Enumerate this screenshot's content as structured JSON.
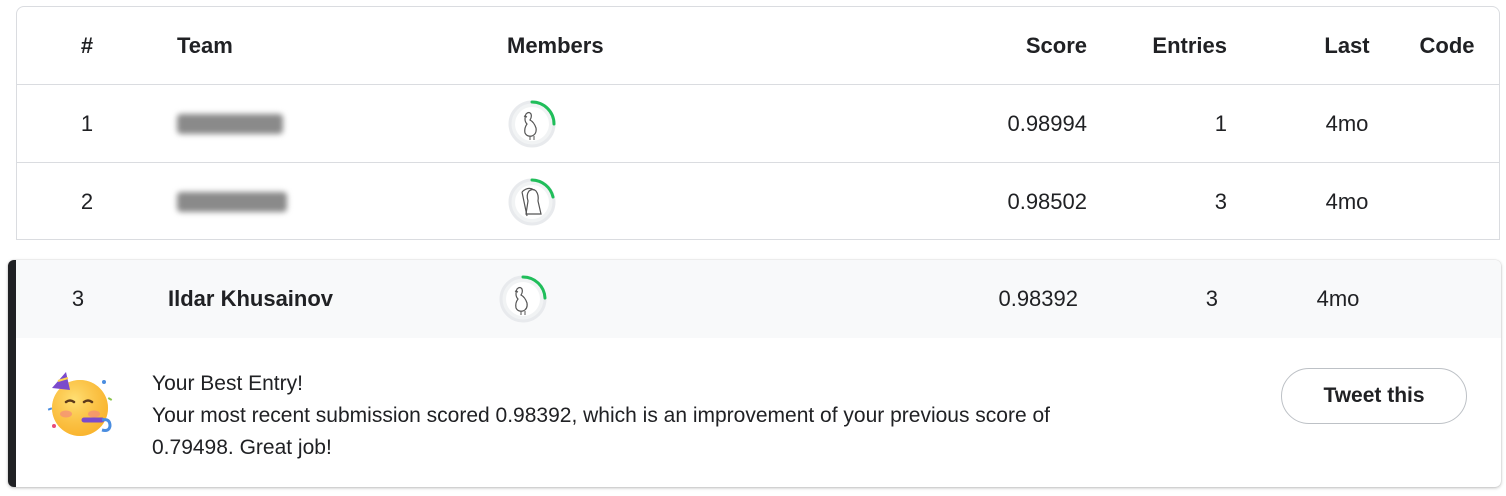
{
  "table": {
    "headers": {
      "rank": "#",
      "team": "Team",
      "members": "Members",
      "score": "Score",
      "entries": "Entries",
      "last": "Last",
      "code": "Code"
    },
    "rows": [
      {
        "rank": "1",
        "team": "",
        "team_redacted": true,
        "avatar": "turkey-avatar-icon",
        "score": "0.98994",
        "entries": "1",
        "last": "4mo"
      },
      {
        "rank": "2",
        "team": "",
        "team_redacted": true,
        "avatar": "reaper-avatar-icon",
        "score": "0.98502",
        "entries": "3",
        "last": "4mo"
      }
    ]
  },
  "user_row": {
    "rank": "3",
    "team": "Ildar Khusainov",
    "avatar": "turkey-avatar-icon",
    "score": "0.98392",
    "entries": "3",
    "last": "4mo"
  },
  "best_entry": {
    "icon": "partying-face-icon",
    "title": "Your Best Entry!",
    "message": "Your most recent submission scored 0.98392, which is an improvement of your previous score of 0.79498. Great job!",
    "tweet_label": "Tweet this"
  },
  "colors": {
    "accent_bar": "#202124",
    "progress_ring": "#20BE5A",
    "border": "#dadce0"
  }
}
